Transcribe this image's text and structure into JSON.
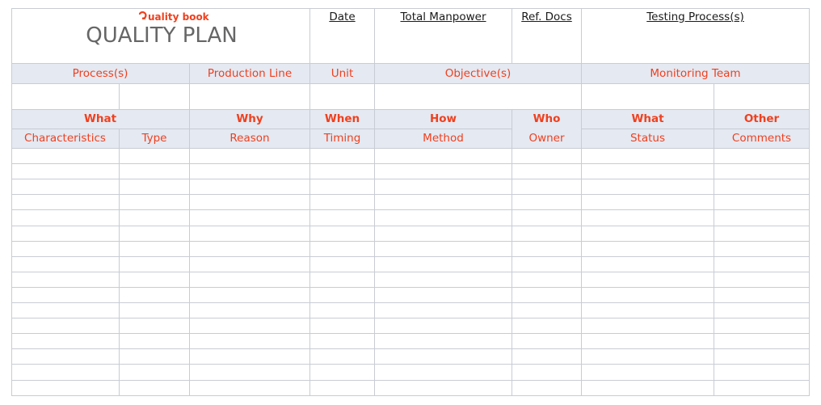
{
  "header": {
    "brand": "uality book",
    "brand_icon": "q-logo-icon",
    "title": "QUALITY PLAN",
    "fields": [
      "Date",
      "Total Manpower",
      "Ref. Docs",
      "Testing Process(s)"
    ]
  },
  "info_row": {
    "labels": [
      "Process(s)",
      "Production Line",
      "Unit",
      "Objective(s)",
      "Monitoring Team"
    ]
  },
  "groups": [
    "What",
    "Why",
    "When",
    "How",
    "Who",
    "What",
    "Other"
  ],
  "columns": [
    "Characteristics",
    "Type",
    "Reason",
    "Timing",
    "Method",
    "Owner",
    "Status",
    "Comments"
  ],
  "table": {
    "empty_rows": 16
  },
  "colors": {
    "accent": "#f0401e",
    "band": "#e4e9f2",
    "grid": "#c8ccd4",
    "title": "#666666"
  }
}
